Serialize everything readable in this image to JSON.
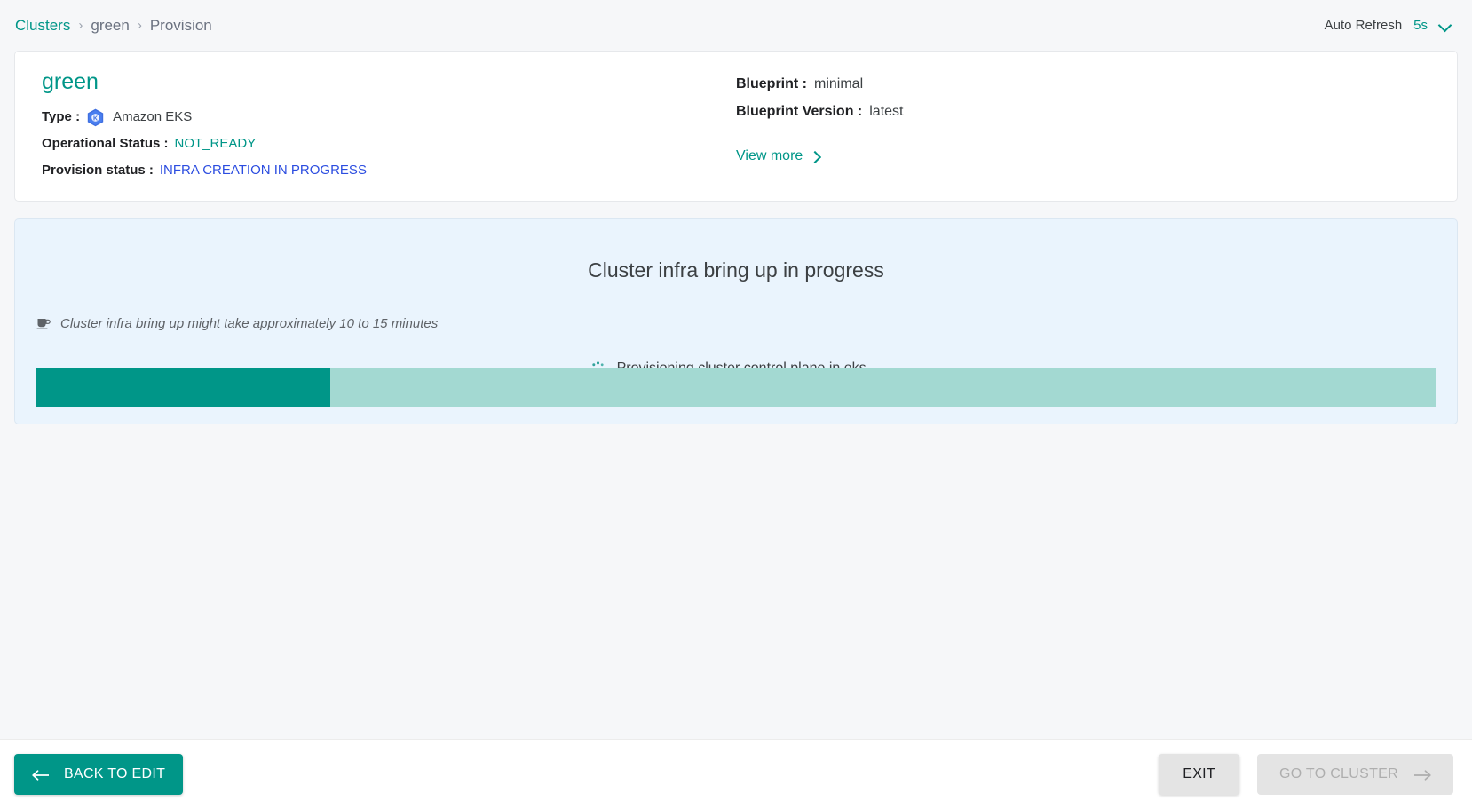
{
  "breadcrumb": {
    "root": "Clusters",
    "cluster": "green",
    "current": "Provision",
    "separator": "›"
  },
  "auto_refresh": {
    "label": "Auto Refresh",
    "interval": "5s",
    "chevron_icon": "chevron-down-icon"
  },
  "summary": {
    "cluster_name": "green",
    "type_key": "Type :",
    "type_value": "Amazon EKS",
    "type_icon": "eks-kubernetes-icon",
    "operational_status_key": "Operational Status :",
    "operational_status_value": "NOT_READY",
    "provision_status_key": "Provision status :",
    "provision_status_value": "INFRA CREATION IN PROGRESS",
    "blueprint_key": "Blueprint :",
    "blueprint_value": "minimal",
    "blueprint_version_key": "Blueprint Version :",
    "blueprint_version_value": "latest",
    "view_more_label": "View more",
    "view_more_icon": "chevron-right-icon"
  },
  "progress_panel": {
    "title": "Cluster infra bring up in progress",
    "note": "Cluster infra bring up might take approximately 10 to 15 minutes",
    "note_icon": "coffee-cup-icon",
    "status_text": "Provisioning cluster control plane in eks ...",
    "status_icon": "loading-spinner-icon",
    "progress_percent": 21
  },
  "footer": {
    "back_label": "BACK TO EDIT",
    "back_icon": "arrow-left-icon",
    "exit_label": "EXIT",
    "go_to_cluster_label": "GO TO CLUSTER",
    "go_to_cluster_icon": "arrow-right-icon"
  },
  "colors": {
    "accent_teal": "#009688",
    "link_blue": "#2c4de0",
    "panel_background": "#eaf4fd",
    "progress_track": "#a3d9d2",
    "page_background": "#f6f7f9"
  }
}
